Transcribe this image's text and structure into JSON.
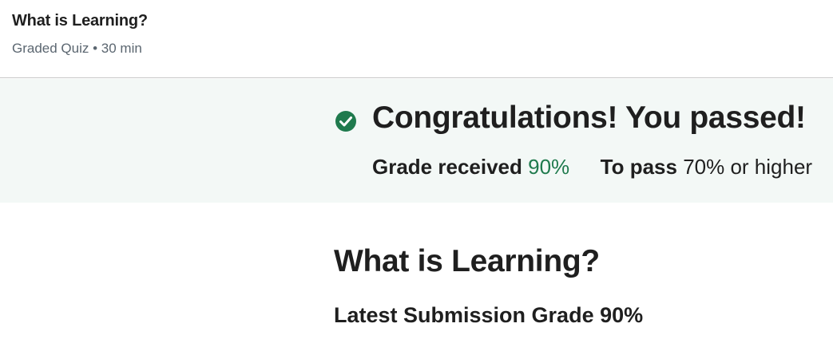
{
  "header": {
    "title": "What is Learning?",
    "subtitle": "Graded Quiz • 30 min"
  },
  "banner": {
    "icon": "check-circle-icon",
    "heading": "Congratulations! You passed!",
    "grade_label": "Grade received",
    "grade_value": "90%",
    "pass_label": "To pass",
    "pass_value": "70% or higher",
    "accent_color": "#1f7a4d",
    "background_color": "#f3f8f6"
  },
  "main": {
    "title": "What is Learning?",
    "latest_submission": "Latest Submission Grade 90%"
  }
}
